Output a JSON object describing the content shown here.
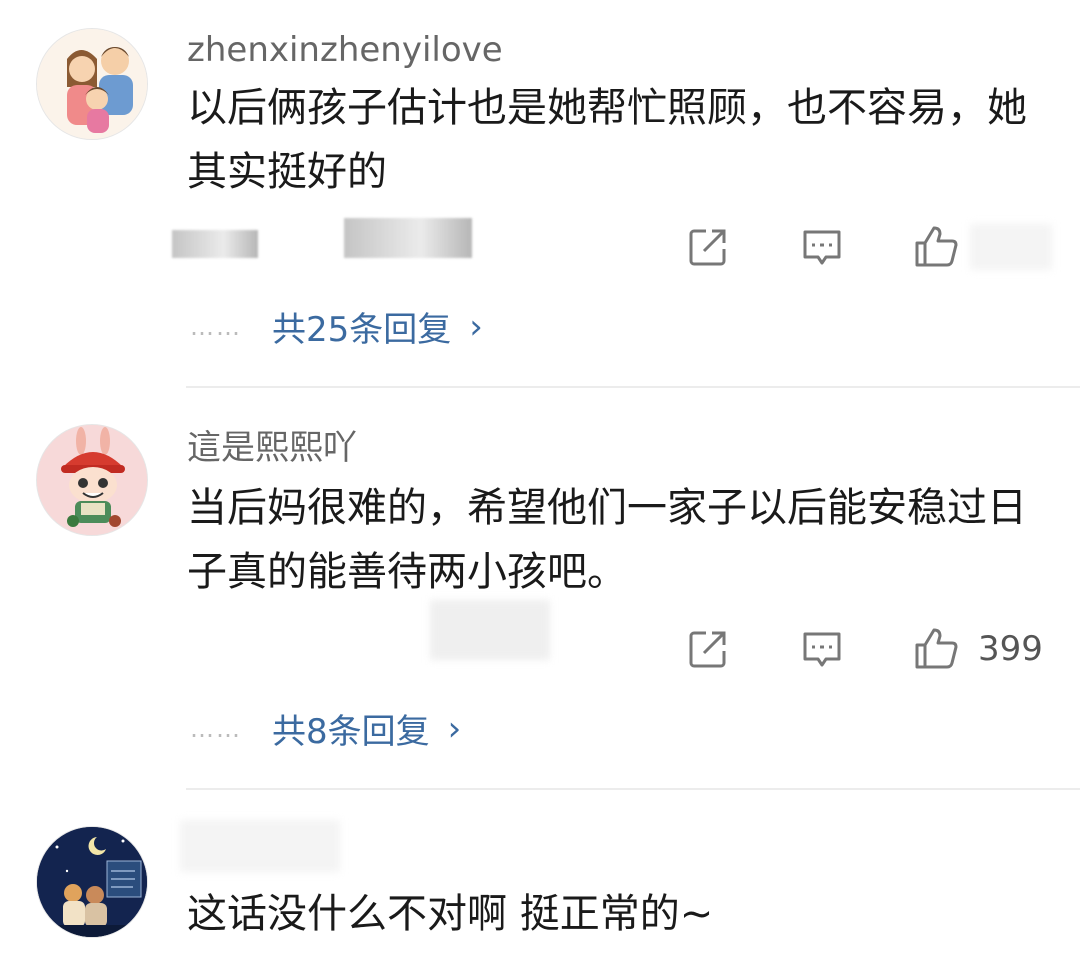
{
  "comments": [
    {
      "username": "zhenxinzhenyilove",
      "text": "以后俩孩子估计也是她帮忙照顾，也不容易，她其实挺好的",
      "replies_label": "共25条回复",
      "replies_prefix": "……",
      "avatar": "family-cartoon-avatar"
    },
    {
      "username": "這是熙熙吖",
      "text": "当后妈很难的，希望他们一家子以后能安稳过日子真的能善待两小孩吧。",
      "likes": "399",
      "replies_label": "共8条回复",
      "replies_prefix": "……",
      "avatar": "red-hat-doll-avatar"
    },
    {
      "username": "",
      "text": "这话没什么不对啊 挺正常的~",
      "avatar": "night-sky-couple-avatar"
    }
  ],
  "icons": {
    "share": "share-icon",
    "comment": "comment-icon",
    "like": "thumbs-up-icon",
    "chevron": "chevron-right-icon"
  },
  "colors": {
    "reply_link": "#3b6aa0",
    "username": "#666666",
    "divider": "#ececec"
  }
}
